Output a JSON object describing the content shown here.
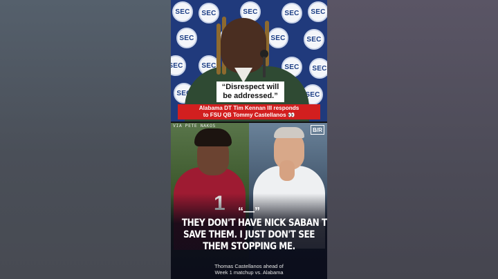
{
  "top_quote": {
    "line1": "“Disrespect will",
    "line2": "be addressed.”"
  },
  "caption": {
    "line1": "Alabama DT Tim Kennan III responds",
    "line2": "to FSU QB Tommy Castellanos 👀"
  },
  "sec_logo_text": "SEC",
  "credit": "VIA PETE NAKOS",
  "brand_logo": "B/R",
  "bottom_quote": {
    "mark": "“—”",
    "line1": "THEY DON'T HAVE NICK SABAN TO",
    "line2": "SAVE THEM. I JUST DON'T SEE",
    "line3": "THEM STOPPING ME."
  },
  "jersey_number": "1",
  "attribution": {
    "line1": "Thomas Castellanos ahead of",
    "line2": "Week 1 matchup vs. Alabama"
  },
  "colors": {
    "caption_red": "#d21f1f",
    "sec_blue": "#203a7c",
    "jersey_crimson": "#9e1b32"
  }
}
